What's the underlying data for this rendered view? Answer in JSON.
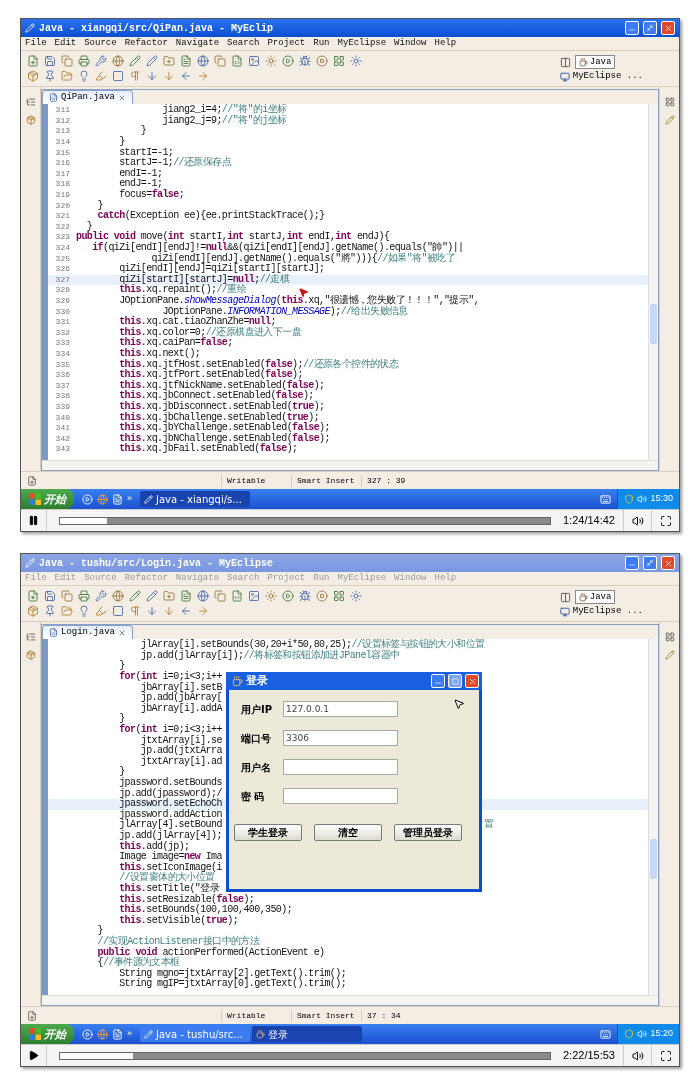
{
  "frames": [
    {
      "active": true,
      "window": {
        "title": "Java - xiangqi/src/QiPan.java - MyEclip"
      },
      "menu": [
        "File",
        "Edit",
        "Source",
        "Refactor",
        "Navigate",
        "Search",
        "Project",
        "Run",
        "MyEclipse",
        "Window",
        "Help"
      ],
      "perspectives": [
        "Java",
        "MyEclipse ..."
      ],
      "editor": {
        "tab": "QiPan.java",
        "line_numbers": true,
        "pointer": true,
        "lines": [
          {
            "number": "311",
            "code": "                jiang2_i=4;",
            "comment": "//\"将\"的i坐标",
            "current": false
          },
          {
            "number": "312",
            "code": "                jiang2_j=9;",
            "comment": "//\"将\"的j坐标",
            "current": false
          },
          {
            "number": "313",
            "code": "            }",
            "current": false
          },
          {
            "number": "314",
            "code": "        }",
            "current": false
          },
          {
            "number": "315",
            "code": "        startI=-1;",
            "current": false
          },
          {
            "number": "316",
            "code": "        startJ=-1;",
            "comment": "//还原保存点",
            "current": false
          },
          {
            "number": "317",
            "code": "        endI=-1;",
            "current": false
          },
          {
            "number": "318",
            "code": "        endJ=-1;",
            "current": false
          },
          {
            "number": "319",
            "code": "        focus=**false**;",
            "current": false
          },
          {
            "number": "320",
            "code": "    }",
            "current": false
          },
          {
            "number": "321",
            "code": "    **catch**(Exception ee){ee.printStackTrace();}",
            "current": false
          },
          {
            "number": "322",
            "code": "  }",
            "current": false
          },
          {
            "number": "323",
            "code": "**public** **void** move(**int** startI,**int** startJ,**int** endI,**int** endJ){",
            "current": false
          },
          {
            "number": "324",
            "code": "   **if**(qiZi[endI][endJ]!=**null**&&(qiZi[endI][endJ].getName().equals(\"帥\")||",
            "current": false
          },
          {
            "number": "325",
            "code": "              qiZi[endI][endJ].getName().equals(\"將\"))){",
            "comment": "//如果\"将\"被吃了",
            "current": false
          },
          {
            "number": "326",
            "code": "        qiZi[endI][endJ]=qiZi[startI][startJ];",
            "current": false
          },
          {
            "number": "327",
            "code": "        qiZi[startI][startJ]=**null**;",
            "comment": "//走棋",
            "current": true
          },
          {
            "number": "328",
            "code": "        **this**.xq.repaint();",
            "comment": "//重绘",
            "current": false
          },
          {
            "number": "329",
            "code": "        JOptionPane.*showMessageDialog*(**this**.xq,\"很遗憾，您失败了！！！\",\"提示\",",
            "current": false
          },
          {
            "number": "330",
            "code": "                JOptionPane.*INFORMATION_MESSAGE*);",
            "comment": "//给出失败信息",
            "current": false
          },
          {
            "number": "331",
            "code": "        **this**.xq.cat.tiaoZhanZhe=**null**;",
            "current": false
          },
          {
            "number": "332",
            "code": "        **this**.xq.color=0;",
            "comment": "//还原棋盘进入下一盘",
            "current": false
          },
          {
            "number": "333",
            "code": "        **this**.xq.caiPan=**false**;",
            "current": false
          },
          {
            "number": "334",
            "code": "        **this**.xq.next();",
            "current": false
          },
          {
            "number": "335",
            "code": "        **this**.xq.jtfHost.setEnabled(**false**);",
            "comment": "//还原各个控件的状态",
            "current": false
          },
          {
            "number": "336",
            "code": "        **this**.xq.jtfPort.setEnabled(**false**);",
            "current": false
          },
          {
            "number": "337",
            "code": "        **this**.xq.jtfNickName.setEnabled(**false**);",
            "current": false
          },
          {
            "number": "338",
            "code": "        **this**.xq.jbConnect.setEnabled(**false**);",
            "current": false
          },
          {
            "number": "339",
            "code": "        **this**.xq.jbDisconnect.setEnabled(**true**);",
            "current": false
          },
          {
            "number": "340",
            "code": "        **this**.xq.jbChallenge.setEnabled(**true**);",
            "current": false
          },
          {
            "number": "341",
            "code": "        **this**.xq.jbYChallenge.setEnabled(**false**);",
            "current": false
          },
          {
            "number": "342",
            "code": "        **this**.xq.jbNChallenge.setEnabled(**false**);",
            "current": false
          },
          {
            "number": "343",
            "code": "        **this**.xq.jbFail.setEnabled(**false**);",
            "current": false
          }
        ]
      },
      "status_bar": [
        "Writable",
        "Smart Insert",
        "327 : 39"
      ],
      "taskbar": {
        "start": "开始",
        "more": "»",
        "tasks": [
          {
            "label": "Java - xiangqi/s...",
            "kind": "ide",
            "selected": true
          }
        ],
        "clock": "15:30"
      },
      "player": {
        "playing": true,
        "level": 0.095,
        "time": "1:24/14:42"
      }
    },
    {
      "active": false,
      "window": {
        "title": "Java - tushu/src/Login.java - MyEclipse"
      },
      "menu": [
        "File",
        "Edit",
        "Source",
        "Refactor",
        "Navigate",
        "Search",
        "Project",
        "Run",
        "MyEclipse",
        "Window",
        "Help"
      ],
      "perspectives": [
        "Java",
        "MyEclipse ..."
      ],
      "editor": {
        "tab": "Login.java",
        "line_numbers": false,
        "pointer": false,
        "lines": [
          {
            "code": "            jlArray[i].setBounds(30,20+i*50,80,25);",
            "comment": "//设置标签与按钮的大小和位置",
            "current": false
          },
          {
            "code": "            jp.add(jlArray[i]);",
            "comment": "//将标签和按钮添加进JPanel容器中",
            "current": false
          },
          {
            "code": "        }",
            "current": false
          },
          {
            "code": "        **for**(**int** i=0;i<3;i++",
            "current": false
          },
          {
            "code": "            jbArray[i].setB",
            "current": false
          },
          {
            "code": "            jp.add(jbArray[",
            "current": false
          },
          {
            "code": "            jbArray[i].addA",
            "current": false
          },
          {
            "code": "        }",
            "current": false
          },
          {
            "code": "        **for**(**int** i=0;i<3;i++",
            "current": false
          },
          {
            "code": "            jtxtArray[i].se",
            "current": false
          },
          {
            "code": "            jp.add(jtxtArra",
            "current": false
          },
          {
            "code": "            jtxtArray[i].ad",
            "current": false
          },
          {
            "code": "        }",
            "current": false
          },
          {
            "code": "        jpassword.setBounds",
            "current": false
          },
          {
            "code": "        jp.add(jpassword);/",
            "current": false
          },
          {
            "code": "        jpassword.setEchoCh",
            "current": true
          },
          {
            "code": "        jpassword.addAction",
            "current": false
          },
          {
            "code": "        jlArray[4].setBound",
            "right": "置",
            "current": false
          },
          {
            "code": "        jp.add(jlArray[4]);",
            "current": false
          },
          {
            "code": "        **this**.add(jp);",
            "current": false
          },
          {
            "code": "        Image image=**new** Ima",
            "current": false
          },
          {
            "code": "        **this**.setIconImage(i",
            "current": false
          },
          {
            "comment": "        //设置窗体的大小位置",
            "current": false
          },
          {
            "code": "        **this**.setTitle(\"登录",
            "current": false
          },
          {
            "code": "        **this**.setResizable(**false**);",
            "current": false
          },
          {
            "code": "        **this**.setBounds(100,100,400,350);",
            "current": false
          },
          {
            "code": "        **this**.setVisible(**true**);",
            "current": false
          },
          {
            "code": "    }",
            "current": false
          },
          {
            "comment": "    //实现ActionListener接口中的方法",
            "current": false
          },
          {
            "code": "    **public** **void** actionPerformed(ActionEvent e)",
            "current": false
          },
          {
            "code": "    {",
            "comment": "//事件源为文本框",
            "current": false
          },
          {
            "code": "        String mgno=jtxtArray[2].getText().trim();",
            "current": false
          },
          {
            "code": "        String mgIP=jtxtArray[0].getText().trim();",
            "current": false
          }
        ],
        "dialog": {
          "title": "登录",
          "pointer": true,
          "fields": [
            {
              "label": "用户IP",
              "value": "127.0.0.1"
            },
            {
              "label": "端口号",
              "value": "3306"
            },
            {
              "label": "用户名"
            },
            {
              "label": "密 码"
            }
          ],
          "buttons": [
            "学生登录",
            "清空",
            "管理员登录"
          ]
        }
      },
      "status_bar": [
        "Writable",
        "Smart Insert",
        "37 : 34"
      ],
      "taskbar": {
        "start": "开始",
        "more": "»",
        "tasks": [
          {
            "label": "Java - tushu/src...",
            "kind": "ide",
            "selected": false
          },
          {
            "label": "登录",
            "kind": "app",
            "selected": true
          }
        ],
        "clock": "15:20"
      },
      "player": {
        "playing": false,
        "level": 0.149,
        "time": "2:22/15:53"
      }
    }
  ]
}
